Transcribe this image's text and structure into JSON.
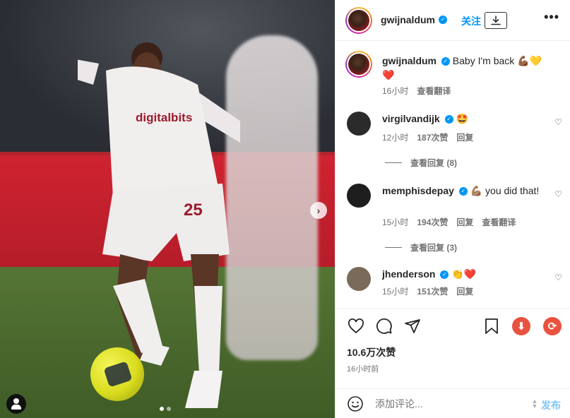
{
  "post": {
    "username": "gwijnaldum",
    "follow_label": "关注",
    "more_label": "•••",
    "next_label": "›"
  },
  "caption": {
    "username": "gwijnaldum",
    "text": "Baby I'm back 💪🏾💛",
    "text2": "❤️",
    "time": "16小时",
    "translate": "查看翻译"
  },
  "comments": [
    {
      "username": "virgilvandijk",
      "text": "🤩",
      "time": "12小时",
      "likes": "187次赞",
      "reply": "回复",
      "replies_label": "查看回复 (8)",
      "avatar_color": "#2b2b2b"
    },
    {
      "username": "memphisdepay",
      "text": "💪🏽 you did that!",
      "time": "15小时",
      "likes": "194次赞",
      "reply": "回复",
      "translate": "查看翻译",
      "replies_label": "查看回复 (3)",
      "avatar_color": "#1e1e1e"
    },
    {
      "username": "jhenderson",
      "text": "👏❤️",
      "time": "15小时",
      "likes": "151次赞",
      "reply": "回复",
      "avatar_color": "#7a6a5a"
    }
  ],
  "actions": {
    "likes": "10.6万次赞",
    "time": "16小时前"
  },
  "composer": {
    "placeholder": "添加评论...",
    "post_label": "发布"
  },
  "colors": {
    "accent": "#0095f6",
    "download": "#e8533f",
    "refresh": "#e8533f"
  }
}
